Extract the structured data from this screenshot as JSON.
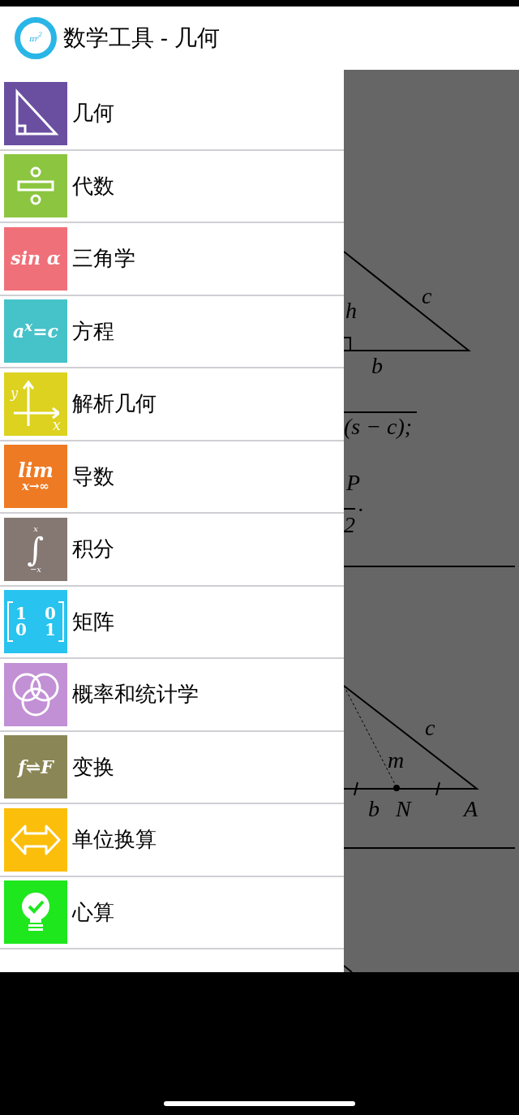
{
  "app_bar": {
    "logo_text": "πr$^{2}$",
    "title": "数学工具 - 几何"
  },
  "drawer": {
    "items": [
      {
        "label": "几何",
        "color": "#6a4fa1",
        "kind": "triangle"
      },
      {
        "label": "代数",
        "color": "#8cc540",
        "kind": "divide"
      },
      {
        "label": "三角学",
        "color": "#f07079",
        "kind": "text",
        "icon_text": [
          "sin α"
        ]
      },
      {
        "label": "方程",
        "color": "#46c2c9",
        "kind": "text",
        "icon_text": [
          "a$^{x}$=c"
        ]
      },
      {
        "label": "解析几何",
        "color": "#dcd21f",
        "kind": "axes",
        "icon_text": [
          "y",
          "x"
        ]
      },
      {
        "label": "导数",
        "color": "#ee7a23",
        "kind": "limit",
        "icon_text": [
          "lim",
          "x→∞"
        ]
      },
      {
        "label": "积分",
        "color": "#857873",
        "kind": "integral",
        "icon_text": [
          "x",
          "∫",
          "−x"
        ]
      },
      {
        "label": "矩阵",
        "color": "#28c3ee",
        "kind": "matrix",
        "icon_text": [
          "1",
          "0",
          "0",
          "1"
        ]
      },
      {
        "label": "概率和统计学",
        "color": "#c290d5",
        "kind": "venn"
      },
      {
        "label": "变换",
        "color": "#8b8656",
        "kind": "text",
        "icon_text": [
          "f⇌F"
        ]
      },
      {
        "label": "单位换算",
        "color": "#fbbe0b",
        "kind": "arrows"
      },
      {
        "label": "心算",
        "color": "#1ee71e",
        "kind": "bulb"
      }
    ]
  },
  "background": {
    "labels": [
      "h",
      "c",
      "b",
      "(s − c);",
      "P",
      "2",
      ".",
      "c",
      "m",
      "b",
      "N",
      "A"
    ]
  }
}
